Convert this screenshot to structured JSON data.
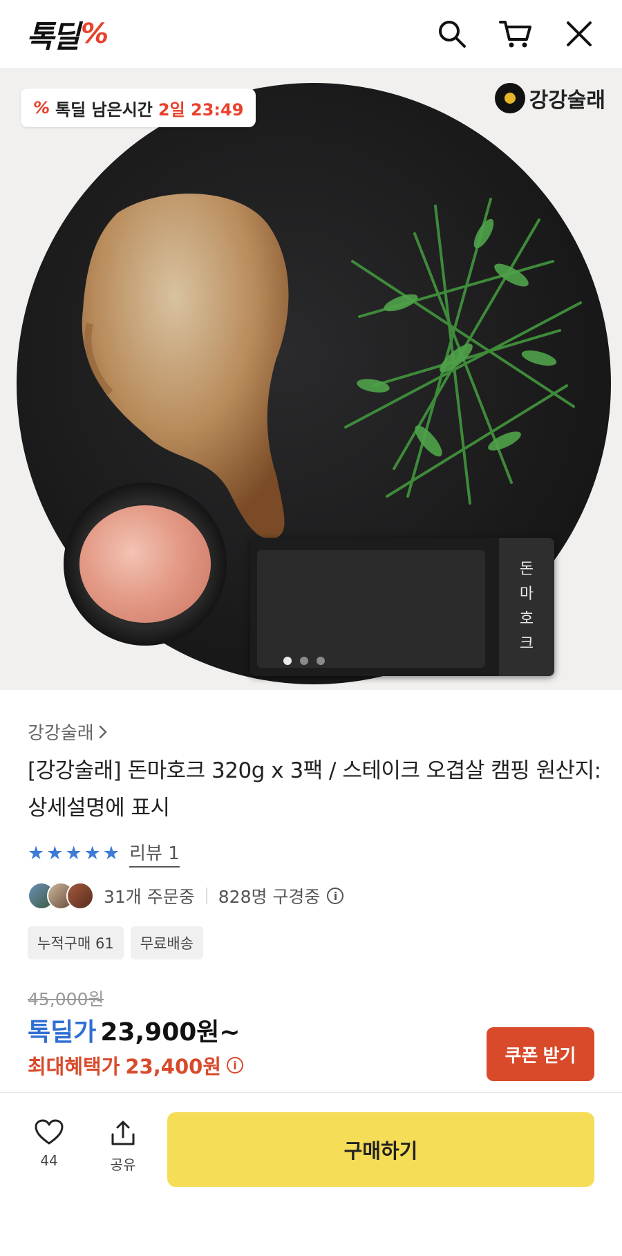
{
  "header": {
    "logo_text": "톡딜",
    "logo_mark": "%",
    "icons": [
      "search-icon",
      "cart-icon",
      "close-icon"
    ]
  },
  "hero": {
    "timer_mark": "%",
    "timer_label": "톡딜 남은시간",
    "timer_value": "2일 23:49",
    "brand_logo_text": "강강술래",
    "pack_label": [
      "돈",
      "마",
      "호",
      "크"
    ],
    "image_dots_total": 3,
    "image_dots_active": 1
  },
  "product": {
    "brand_link": "강강술래",
    "title": "[강강술래] 돈마호크 320g x 3팩 / 스테이크 오겹살 캠핑 원산지: 상세설명에 표시",
    "rating_stars": 5,
    "review_link": "리뷰 1",
    "orders_text": "31개 주문중",
    "watchers_text": "828명 구경중",
    "tags": [
      "누적구매 61",
      "무료배송"
    ],
    "original_price": "45,000원",
    "deal_label": "톡딜가",
    "deal_price": "23,900원~",
    "max_benefit_label": "최대혜택가",
    "max_benefit_price": "23,400원",
    "coupon_button": "쿠폰 받기"
  },
  "bottom_bar": {
    "like_count": "44",
    "share_label": "공유",
    "buy_button": "구매하기"
  },
  "colors": {
    "accent_red": "#e8412d",
    "deal_blue": "#2f6fd3",
    "benefit_red": "#d94a2b",
    "buy_yellow": "#f5dd57",
    "star_blue": "#3c7bd7"
  }
}
